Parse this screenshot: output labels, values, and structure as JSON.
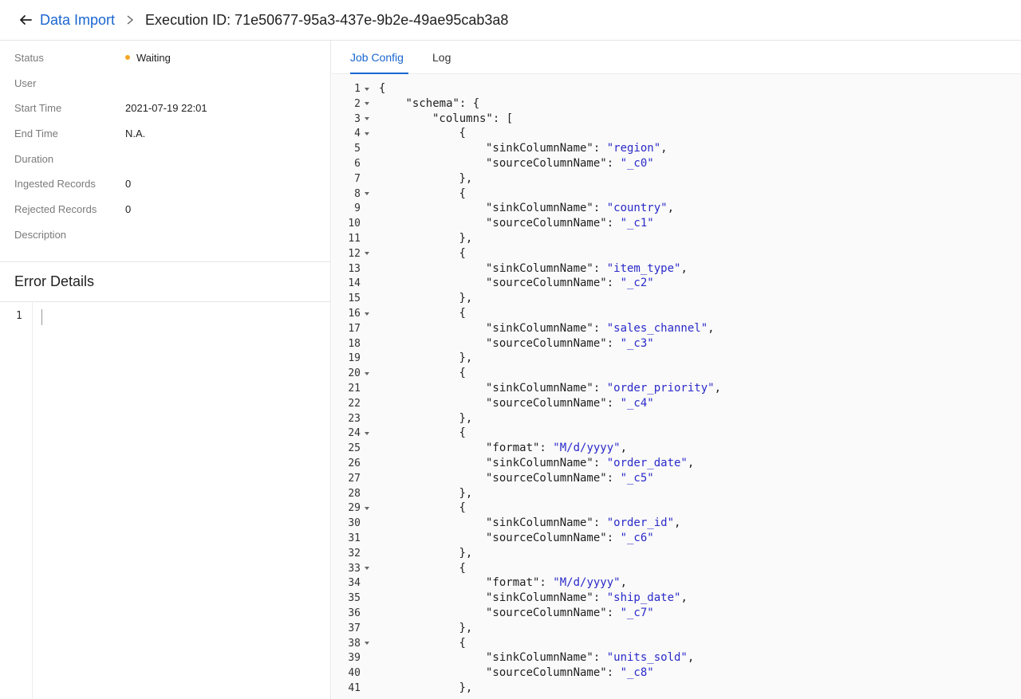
{
  "header": {
    "back_icon": "arrow-left-icon",
    "breadcrumb_link": "Data Import",
    "separator_icon": "chevron-right-icon",
    "title": "Execution ID: 71e50677-95a3-437e-9b2e-49ae95cab3a8"
  },
  "details": [
    {
      "label": "Status",
      "value": "Waiting"
    },
    {
      "label": "User",
      "value": ""
    },
    {
      "label": "Start Time",
      "value": "2021-07-19 22:01"
    },
    {
      "label": "End Time",
      "value": "N.A."
    },
    {
      "label": "Duration",
      "value": ""
    },
    {
      "label": "Ingested Records",
      "value": "0"
    },
    {
      "label": "Rejected Records",
      "value": "0"
    },
    {
      "label": "Description",
      "value": ""
    }
  ],
  "status_color": "#f5a623",
  "error_details": {
    "title": "Error Details",
    "line_number": "1"
  },
  "tabs": [
    {
      "label": "Job Config",
      "active": true
    },
    {
      "label": "Log",
      "active": false
    }
  ],
  "accent_color": "#1a66d1",
  "code": {
    "lines": [
      {
        "n": "1",
        "fold": true,
        "indent": 0,
        "segs": [
          [
            "p",
            "{"
          ]
        ]
      },
      {
        "n": "2",
        "fold": true,
        "indent": 1,
        "segs": [
          [
            "p",
            "\"schema\": {"
          ]
        ]
      },
      {
        "n": "3",
        "fold": true,
        "indent": 2,
        "segs": [
          [
            "p",
            "\"columns\": ["
          ]
        ]
      },
      {
        "n": "4",
        "fold": true,
        "indent": 3,
        "segs": [
          [
            "p",
            "{"
          ]
        ]
      },
      {
        "n": "5",
        "fold": false,
        "indent": 4,
        "segs": [
          [
            "p",
            "\"sinkColumnName\": "
          ],
          [
            "s",
            "\"region\""
          ],
          [
            "p",
            ","
          ]
        ]
      },
      {
        "n": "6",
        "fold": false,
        "indent": 4,
        "segs": [
          [
            "p",
            "\"sourceColumnName\": "
          ],
          [
            "s",
            "\"_c0\""
          ]
        ]
      },
      {
        "n": "7",
        "fold": false,
        "indent": 3,
        "segs": [
          [
            "p",
            "},"
          ]
        ]
      },
      {
        "n": "8",
        "fold": true,
        "indent": 3,
        "segs": [
          [
            "p",
            "{"
          ]
        ]
      },
      {
        "n": "9",
        "fold": false,
        "indent": 4,
        "segs": [
          [
            "p",
            "\"sinkColumnName\": "
          ],
          [
            "s",
            "\"country\""
          ],
          [
            "p",
            ","
          ]
        ]
      },
      {
        "n": "10",
        "fold": false,
        "indent": 4,
        "segs": [
          [
            "p",
            "\"sourceColumnName\": "
          ],
          [
            "s",
            "\"_c1\""
          ]
        ]
      },
      {
        "n": "11",
        "fold": false,
        "indent": 3,
        "segs": [
          [
            "p",
            "},"
          ]
        ]
      },
      {
        "n": "12",
        "fold": true,
        "indent": 3,
        "segs": [
          [
            "p",
            "{"
          ]
        ]
      },
      {
        "n": "13",
        "fold": false,
        "indent": 4,
        "segs": [
          [
            "p",
            "\"sinkColumnName\": "
          ],
          [
            "s",
            "\"item_type\""
          ],
          [
            "p",
            ","
          ]
        ]
      },
      {
        "n": "14",
        "fold": false,
        "indent": 4,
        "segs": [
          [
            "p",
            "\"sourceColumnName\": "
          ],
          [
            "s",
            "\"_c2\""
          ]
        ]
      },
      {
        "n": "15",
        "fold": false,
        "indent": 3,
        "segs": [
          [
            "p",
            "},"
          ]
        ]
      },
      {
        "n": "16",
        "fold": true,
        "indent": 3,
        "segs": [
          [
            "p",
            "{"
          ]
        ]
      },
      {
        "n": "17",
        "fold": false,
        "indent": 4,
        "segs": [
          [
            "p",
            "\"sinkColumnName\": "
          ],
          [
            "s",
            "\"sales_channel\""
          ],
          [
            "p",
            ","
          ]
        ]
      },
      {
        "n": "18",
        "fold": false,
        "indent": 4,
        "segs": [
          [
            "p",
            "\"sourceColumnName\": "
          ],
          [
            "s",
            "\"_c3\""
          ]
        ]
      },
      {
        "n": "19",
        "fold": false,
        "indent": 3,
        "segs": [
          [
            "p",
            "},"
          ]
        ]
      },
      {
        "n": "20",
        "fold": true,
        "indent": 3,
        "segs": [
          [
            "p",
            "{"
          ]
        ]
      },
      {
        "n": "21",
        "fold": false,
        "indent": 4,
        "segs": [
          [
            "p",
            "\"sinkColumnName\": "
          ],
          [
            "s",
            "\"order_priority\""
          ],
          [
            "p",
            ","
          ]
        ]
      },
      {
        "n": "22",
        "fold": false,
        "indent": 4,
        "segs": [
          [
            "p",
            "\"sourceColumnName\": "
          ],
          [
            "s",
            "\"_c4\""
          ]
        ]
      },
      {
        "n": "23",
        "fold": false,
        "indent": 3,
        "segs": [
          [
            "p",
            "},"
          ]
        ]
      },
      {
        "n": "24",
        "fold": true,
        "indent": 3,
        "segs": [
          [
            "p",
            "{"
          ]
        ]
      },
      {
        "n": "25",
        "fold": false,
        "indent": 4,
        "segs": [
          [
            "p",
            "\"format\": "
          ],
          [
            "s",
            "\"M/d/yyyy\""
          ],
          [
            "p",
            ","
          ]
        ]
      },
      {
        "n": "26",
        "fold": false,
        "indent": 4,
        "segs": [
          [
            "p",
            "\"sinkColumnName\": "
          ],
          [
            "s",
            "\"order_date\""
          ],
          [
            "p",
            ","
          ]
        ]
      },
      {
        "n": "27",
        "fold": false,
        "indent": 4,
        "segs": [
          [
            "p",
            "\"sourceColumnName\": "
          ],
          [
            "s",
            "\"_c5\""
          ]
        ]
      },
      {
        "n": "28",
        "fold": false,
        "indent": 3,
        "segs": [
          [
            "p",
            "},"
          ]
        ]
      },
      {
        "n": "29",
        "fold": true,
        "indent": 3,
        "segs": [
          [
            "p",
            "{"
          ]
        ]
      },
      {
        "n": "30",
        "fold": false,
        "indent": 4,
        "segs": [
          [
            "p",
            "\"sinkColumnName\": "
          ],
          [
            "s",
            "\"order_id\""
          ],
          [
            "p",
            ","
          ]
        ]
      },
      {
        "n": "31",
        "fold": false,
        "indent": 4,
        "segs": [
          [
            "p",
            "\"sourceColumnName\": "
          ],
          [
            "s",
            "\"_c6\""
          ]
        ]
      },
      {
        "n": "32",
        "fold": false,
        "indent": 3,
        "segs": [
          [
            "p",
            "},"
          ]
        ]
      },
      {
        "n": "33",
        "fold": true,
        "indent": 3,
        "segs": [
          [
            "p",
            "{"
          ]
        ]
      },
      {
        "n": "34",
        "fold": false,
        "indent": 4,
        "segs": [
          [
            "p",
            "\"format\": "
          ],
          [
            "s",
            "\"M/d/yyyy\""
          ],
          [
            "p",
            ","
          ]
        ]
      },
      {
        "n": "35",
        "fold": false,
        "indent": 4,
        "segs": [
          [
            "p",
            "\"sinkColumnName\": "
          ],
          [
            "s",
            "\"ship_date\""
          ],
          [
            "p",
            ","
          ]
        ]
      },
      {
        "n": "36",
        "fold": false,
        "indent": 4,
        "segs": [
          [
            "p",
            "\"sourceColumnName\": "
          ],
          [
            "s",
            "\"_c7\""
          ]
        ]
      },
      {
        "n": "37",
        "fold": false,
        "indent": 3,
        "segs": [
          [
            "p",
            "},"
          ]
        ]
      },
      {
        "n": "38",
        "fold": true,
        "indent": 3,
        "segs": [
          [
            "p",
            "{"
          ]
        ]
      },
      {
        "n": "39",
        "fold": false,
        "indent": 4,
        "segs": [
          [
            "p",
            "\"sinkColumnName\": "
          ],
          [
            "s",
            "\"units_sold\""
          ],
          [
            "p",
            ","
          ]
        ]
      },
      {
        "n": "40",
        "fold": false,
        "indent": 4,
        "segs": [
          [
            "p",
            "\"sourceColumnName\": "
          ],
          [
            "s",
            "\"_c8\""
          ]
        ]
      },
      {
        "n": "41",
        "fold": false,
        "indent": 3,
        "segs": [
          [
            "p",
            "},"
          ]
        ]
      }
    ]
  }
}
